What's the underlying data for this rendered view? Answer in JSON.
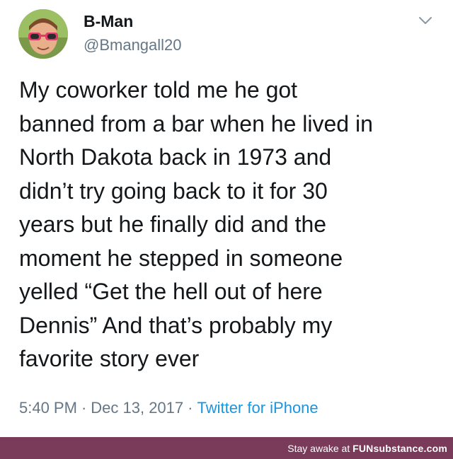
{
  "tweet": {
    "display_name": "B-Man",
    "handle": "@Bmangall20",
    "avatar_icon": "avatar-with-sunglasses",
    "menu_icon": "chevron-down-icon",
    "text_lines": [
      "My coworker told me he got",
      "banned from a bar when he lived in",
      "North Dakota back in 1973 and",
      "didn’t try going back to it for 30",
      "years but he finally did and the",
      "moment he stepped in someone",
      "yelled “Get the hell out of here",
      "Dennis” And that’s probably my",
      "favorite story ever"
    ],
    "time": "5:40 PM",
    "date": "Dec 13, 2017",
    "source": "Twitter for iPhone",
    "separator": "·"
  },
  "footer": {
    "prefix": "Stay awake at ",
    "brand": "FUNsubstance.com"
  },
  "colors": {
    "text": "#14171a",
    "muted": "#657786",
    "link": "#1b95e0",
    "footer_bg": "#7a3a5a"
  }
}
